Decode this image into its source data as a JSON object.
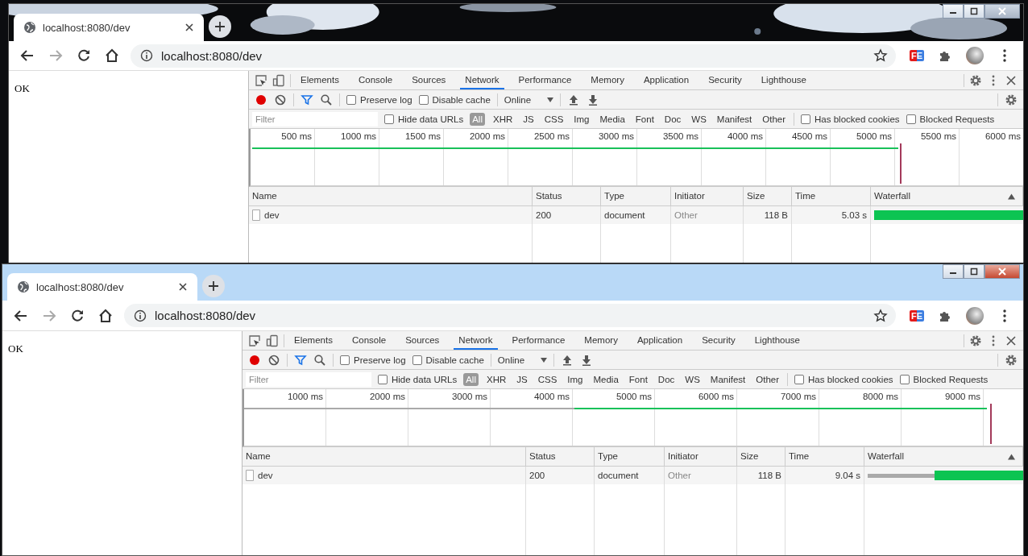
{
  "windows": [
    {
      "tab": {
        "title": "localhost:8080/dev"
      },
      "address": "localhost:8080/dev",
      "extension": "FE",
      "page_text": "OK",
      "devtools": {
        "tabs": [
          {
            "label": "Elements",
            "selected": false
          },
          {
            "label": "Console",
            "selected": false
          },
          {
            "label": "Sources",
            "selected": false
          },
          {
            "label": "Network",
            "selected": true
          },
          {
            "label": "Performance",
            "selected": false
          },
          {
            "label": "Memory",
            "selected": false
          },
          {
            "label": "Application",
            "selected": false
          },
          {
            "label": "Security",
            "selected": false
          },
          {
            "label": "Lighthouse",
            "selected": false
          }
        ],
        "recording": true,
        "preserve_log": {
          "label": "Preserve log",
          "checked": false
        },
        "disable_cache": {
          "label": "Disable cache",
          "checked": false
        },
        "throttling": "Online",
        "filter": {
          "placeholder": "Filter",
          "hide_data_urls": {
            "label": "Hide data URLs",
            "checked": false
          },
          "has_blocked_cookies": {
            "label": "Has blocked cookies",
            "checked": false
          },
          "blocked_requests": {
            "label": "Blocked Requests",
            "checked": false
          },
          "types": [
            {
              "label": "All",
              "selected": true
            },
            {
              "label": "XHR",
              "selected": false
            },
            {
              "label": "JS",
              "selected": false
            },
            {
              "label": "CSS",
              "selected": false
            },
            {
              "label": "Img",
              "selected": false
            },
            {
              "label": "Media",
              "selected": false
            },
            {
              "label": "Font",
              "selected": false
            },
            {
              "label": "Doc",
              "selected": false
            },
            {
              "label": "WS",
              "selected": false
            },
            {
              "label": "Manifest",
              "selected": false
            },
            {
              "label": "Other",
              "selected": false
            }
          ]
        },
        "timeline_ticks": [
          "500 ms",
          "1000 ms",
          "1500 ms",
          "2000 ms",
          "2500 ms",
          "3000 ms",
          "3500 ms",
          "4000 ms",
          "4500 ms",
          "5000 ms",
          "5500 ms",
          "6000 ms"
        ],
        "table": {
          "columns": [
            "Name",
            "Status",
            "Type",
            "Initiator",
            "Size",
            "Time",
            "Waterfall"
          ],
          "rows": [
            {
              "name": "dev",
              "status": "200",
              "type": "document",
              "initiator": "Other",
              "size": "118 B",
              "time": "5.03 s"
            }
          ]
        }
      }
    },
    {
      "tab": {
        "title": "localhost:8080/dev"
      },
      "address": "localhost:8080/dev",
      "extension": "FE",
      "page_text": "OK",
      "devtools": {
        "tabs": [
          {
            "label": "Elements",
            "selected": false
          },
          {
            "label": "Console",
            "selected": false
          },
          {
            "label": "Sources",
            "selected": false
          },
          {
            "label": "Network",
            "selected": true
          },
          {
            "label": "Performance",
            "selected": false
          },
          {
            "label": "Memory",
            "selected": false
          },
          {
            "label": "Application",
            "selected": false
          },
          {
            "label": "Security",
            "selected": false
          },
          {
            "label": "Lighthouse",
            "selected": false
          }
        ],
        "recording": true,
        "preserve_log": {
          "label": "Preserve log",
          "checked": false
        },
        "disable_cache": {
          "label": "Disable cache",
          "checked": false
        },
        "throttling": "Online",
        "filter": {
          "placeholder": "Filter",
          "hide_data_urls": {
            "label": "Hide data URLs",
            "checked": false
          },
          "has_blocked_cookies": {
            "label": "Has blocked cookies",
            "checked": false
          },
          "blocked_requests": {
            "label": "Blocked Requests",
            "checked": false
          },
          "types": [
            {
              "label": "All",
              "selected": true
            },
            {
              "label": "XHR",
              "selected": false
            },
            {
              "label": "JS",
              "selected": false
            },
            {
              "label": "CSS",
              "selected": false
            },
            {
              "label": "Img",
              "selected": false
            },
            {
              "label": "Media",
              "selected": false
            },
            {
              "label": "Font",
              "selected": false
            },
            {
              "label": "Doc",
              "selected": false
            },
            {
              "label": "WS",
              "selected": false
            },
            {
              "label": "Manifest",
              "selected": false
            },
            {
              "label": "Other",
              "selected": false
            }
          ]
        },
        "timeline_ticks": [
          "1000 ms",
          "2000 ms",
          "3000 ms",
          "4000 ms",
          "5000 ms",
          "6000 ms",
          "7000 ms",
          "8000 ms",
          "9000 ms"
        ],
        "table": {
          "columns": [
            "Name",
            "Status",
            "Type",
            "Initiator",
            "Size",
            "Time",
            "Waterfall"
          ],
          "rows": [
            {
              "name": "dev",
              "status": "200",
              "type": "document",
              "initiator": "Other",
              "size": "118 B",
              "time": "9.04 s"
            }
          ]
        }
      }
    }
  ]
}
